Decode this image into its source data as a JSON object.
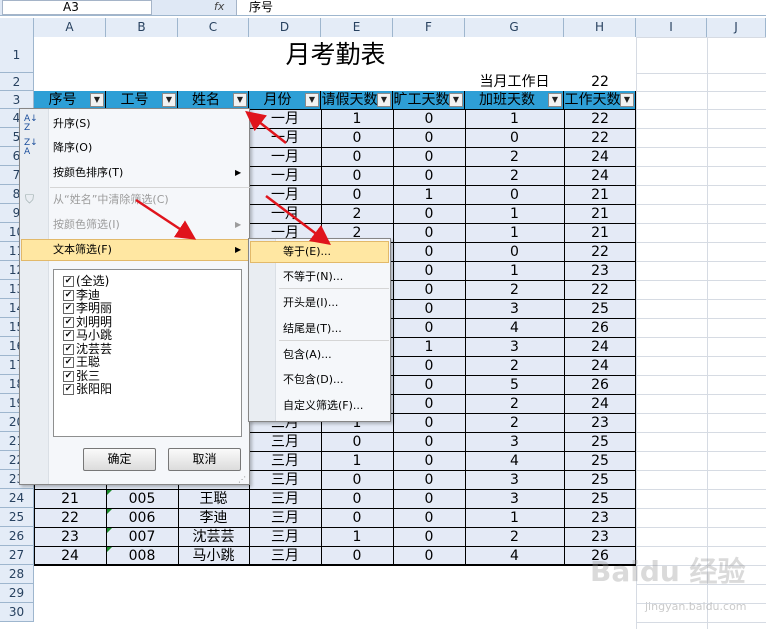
{
  "formula_bar": {
    "name_box": "A3",
    "fx": "fx",
    "content": "序号"
  },
  "columns": [
    "A",
    "B",
    "C",
    "D",
    "E",
    "F",
    "G",
    "H",
    "I",
    "J"
  ],
  "rows": [
    "1",
    "2",
    "3",
    "4",
    "5",
    "6",
    "7",
    "8",
    "9",
    "10",
    "11",
    "12",
    "13",
    "14",
    "15",
    "16",
    "17",
    "18",
    "19",
    "20",
    "21",
    "22",
    "23",
    "24",
    "25",
    "26",
    "27",
    "28",
    "29",
    "30"
  ],
  "title": "月考勤表",
  "workday_label": "当月工作日",
  "workday_value": "22",
  "headers": {
    "a": "序号",
    "b": "工号",
    "c": "姓名",
    "d": "月份",
    "e": "请假天数",
    "f": "旷工天数",
    "g": "加班天数",
    "h": "工作天数"
  },
  "visible_rows": {
    "r4": {
      "d": "一月",
      "e": "1",
      "f": "0",
      "g": "1",
      "h": "22"
    },
    "r5": {
      "d": "一月",
      "e": "0",
      "f": "0",
      "g": "0",
      "h": "22"
    },
    "r6": {
      "d": "一月",
      "e": "0",
      "f": "0",
      "g": "2",
      "h": "24"
    },
    "r7": {
      "d": "一月",
      "e": "0",
      "f": "0",
      "g": "2",
      "h": "24"
    },
    "r8": {
      "d": "一月",
      "e": "0",
      "f": "1",
      "g": "0",
      "h": "21"
    },
    "r9": {
      "d": "一月",
      "e": "2",
      "f": "0",
      "g": "1",
      "h": "21"
    },
    "r10": {
      "d": "一月",
      "e": "2",
      "f": "0",
      "g": "1",
      "h": "21"
    },
    "r11": {
      "f": "0",
      "g": "0",
      "h": "22"
    },
    "r12": {
      "f": "0",
      "g": "1",
      "h": "23"
    },
    "r13": {
      "f": "0",
      "g": "2",
      "h": "22"
    },
    "r14": {
      "f": "0",
      "g": "3",
      "h": "25"
    },
    "r15": {
      "f": "0",
      "g": "4",
      "h": "26"
    },
    "r16": {
      "f": "1",
      "g": "3",
      "h": "24"
    },
    "r17": {
      "f": "0",
      "g": "2",
      "h": "24"
    },
    "r18": {
      "f": "0",
      "g": "5",
      "h": "26"
    },
    "r19": {
      "f": "0",
      "g": "2",
      "h": "24"
    },
    "r20": {
      "d": "三月",
      "e": "1",
      "f": "0",
      "g": "2",
      "h": "23"
    },
    "r21": {
      "d": "三月",
      "e": "0",
      "f": "0",
      "g": "3",
      "h": "25"
    },
    "r22": {
      "d": "三月",
      "e": "1",
      "f": "0",
      "g": "4",
      "h": "25"
    },
    "r23": {
      "d": "三月",
      "e": "0",
      "f": "0",
      "g": "3",
      "h": "25"
    },
    "r24": {
      "a": "21",
      "b": "005",
      "c": "王聪",
      "d": "三月",
      "e": "0",
      "f": "0",
      "g": "3",
      "h": "25"
    },
    "r25": {
      "a": "22",
      "b": "006",
      "c": "李迪",
      "d": "三月",
      "e": "0",
      "f": "0",
      "g": "1",
      "h": "23"
    },
    "r26": {
      "a": "23",
      "b": "007",
      "c": "沈芸芸",
      "d": "三月",
      "e": "1",
      "f": "0",
      "g": "2",
      "h": "23"
    },
    "r27": {
      "a": "24",
      "b": "008",
      "c": "马小跳",
      "d": "三月",
      "e": "0",
      "f": "0",
      "g": "4",
      "h": "26"
    }
  },
  "menu": {
    "sort_asc": "升序(S)",
    "sort_desc": "降序(O)",
    "sort_color": "按颜色排序(T)",
    "clear_filter": "从“姓名”中清除筛选(C)",
    "filter_color": "按颜色筛选(I)",
    "text_filter": "文本筛选(F)",
    "list": [
      "(全选)",
      "李迪",
      "李明丽",
      "刘明明",
      "马小跳",
      "沈芸芸",
      "王聪",
      "张三",
      "张阳阳"
    ],
    "ok": "确定",
    "cancel": "取消"
  },
  "submenu": [
    "等于(E)...",
    "不等于(N)...",
    "开头是(I)...",
    "结尾是(T)...",
    "包含(A)...",
    "不包含(D)...",
    "自定义筛选(F)..."
  ],
  "watermark": {
    "brand": "Baidu 经验",
    "url": "jingyan.baidu.com"
  },
  "colors": {
    "header_fill": "#2e9fd6",
    "data_fill": "#e4eaf6",
    "menu_highlight": "#ffe7a2",
    "arrow": "#e0141c"
  }
}
